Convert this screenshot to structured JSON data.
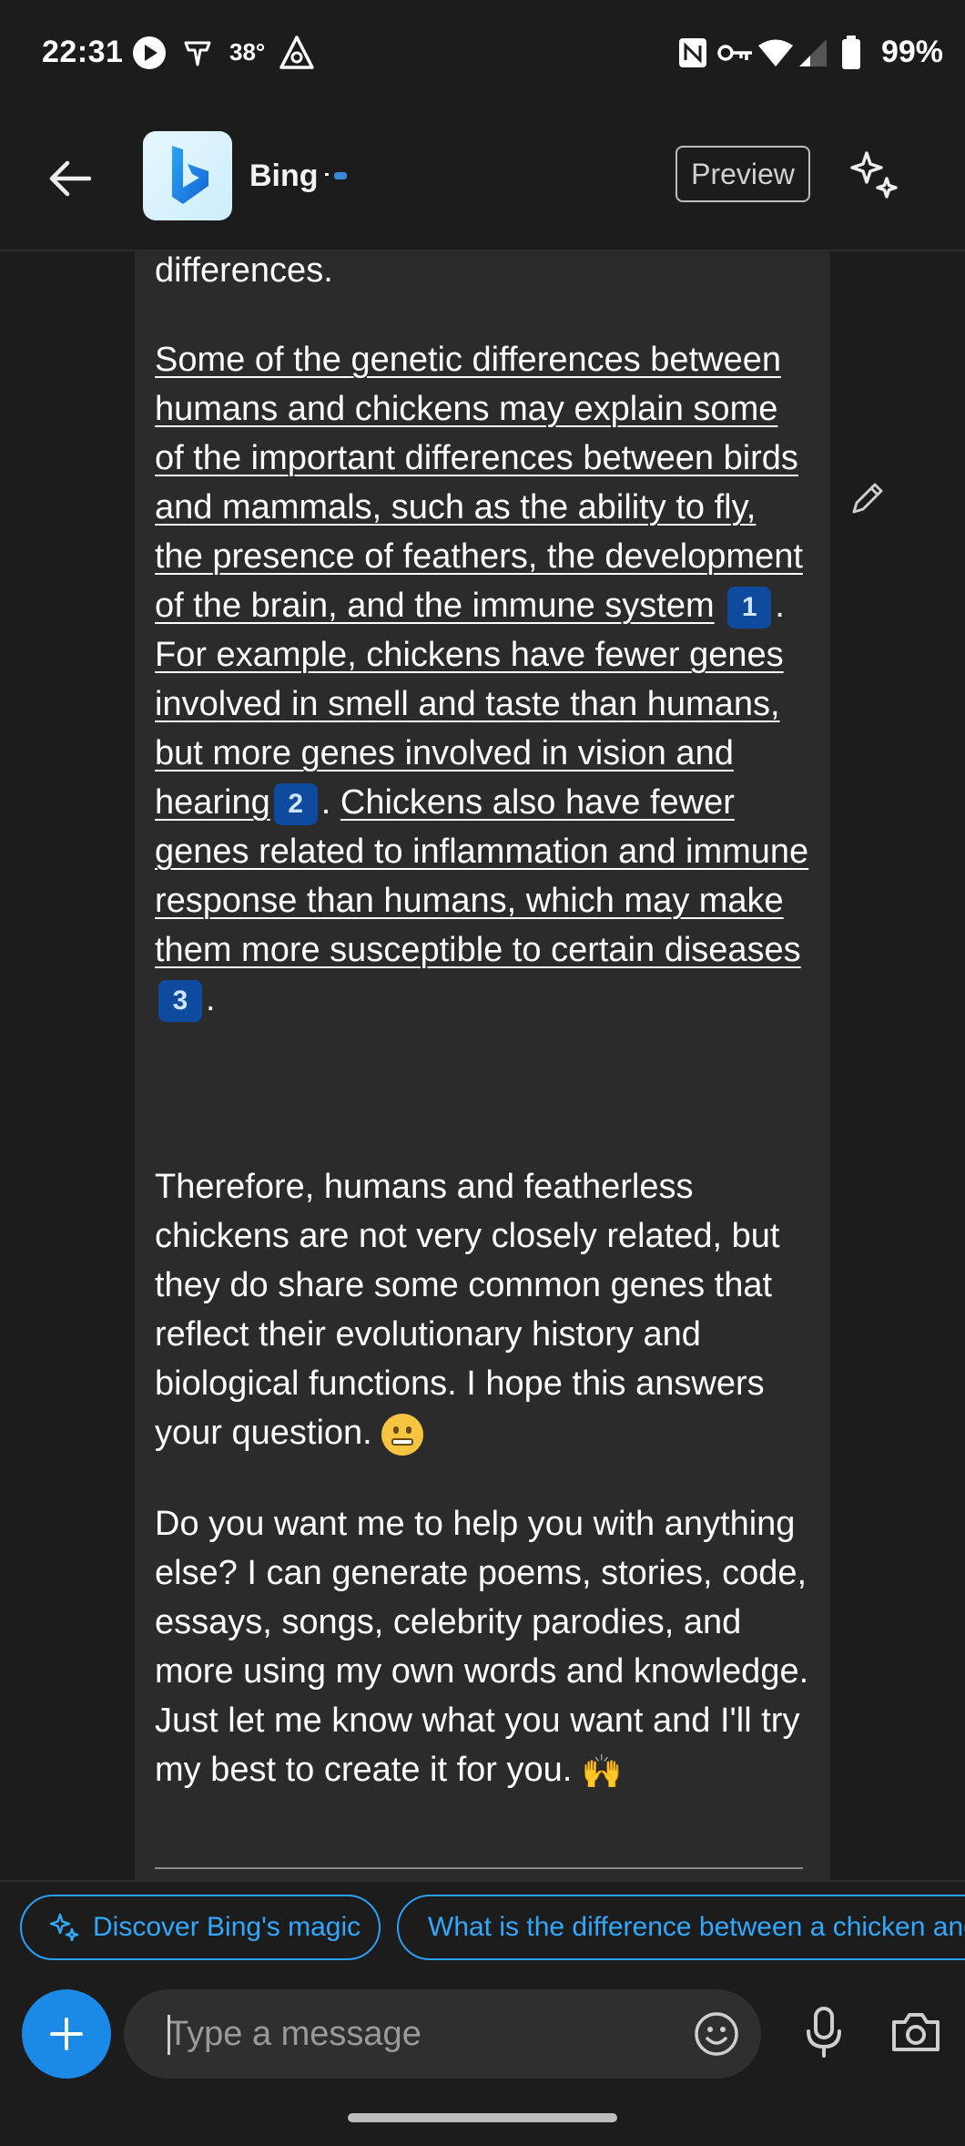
{
  "status_bar": {
    "time": "22:31",
    "temperature": "38°",
    "battery": "99%",
    "icons": [
      "play-icon",
      "notification-icon",
      "navigation-icon",
      "nfc-icon",
      "key-icon",
      "wifi-icon",
      "signal-icon",
      "battery-icon"
    ]
  },
  "header": {
    "title": "Bing",
    "preview_label": "Preview",
    "back_icon": "arrow-left-icon",
    "logo_icon": "bing-logo-icon",
    "action_icon": "sparkle-icon"
  },
  "message": {
    "p0": "differences.",
    "p1": {
      "s1": "Some of the genetic differences between humans and chickens may explain some of the important differences between birds and mammals, such as the ability to fly, the presence of feathers, the development of the brain, and the immune system",
      "c1": "1",
      "s2": "For example, chickens have fewer genes involved in smell and taste than humans, but more genes involved in vision and hearing",
      "c2": "2",
      "s3": "Chickens also have fewer genes related to inflammation and immune response than humans, which may make them more susceptible to certain diseases",
      "c3": "3"
    },
    "p2": "Therefore, humans and featherless chickens are not very closely related, but they do share some common genes that reflect their evolutionary history and biological functions. I hope this answers your question.",
    "p3": "Do you want me to help you with anything else? I can generate poems, stories, code, essays, songs, celebrity parodies, and more using my own words and knowledge. Just let me know what you want and I'll try my best to create it for you."
  },
  "suggestions": [
    {
      "label": "Discover Bing's magic"
    },
    {
      "label": "What is the difference between a chicken and"
    }
  ],
  "input": {
    "placeholder": "Type a message"
  },
  "colors": {
    "background": "#1c1c1c",
    "bubble": "#2b2b2b",
    "accent": "#1a8ae6",
    "chip_text": "#33a8ff",
    "citation_bg": "#0e4a9e"
  }
}
